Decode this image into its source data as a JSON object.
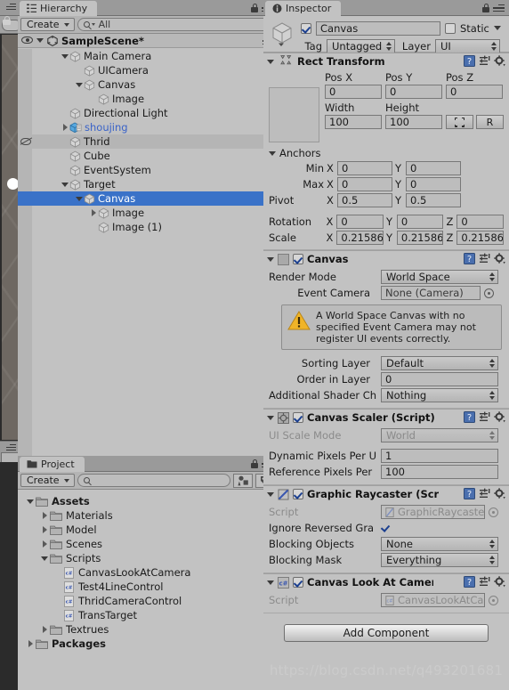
{
  "scene_sliver": {
    "name": "scene-view-sliver"
  },
  "hierarchy": {
    "tab_label": "Hierarchy",
    "create_label": "Create",
    "search_placeholder": "All",
    "search_value": "All",
    "scene_name": "SampleScene*",
    "selection_color": "#3a72c8",
    "items": [
      {
        "label": "Main Camera",
        "indent": 2,
        "expand": "down",
        "icon": "cube-icon",
        "selected": false,
        "alt": false,
        "hidden": false,
        "prefab": false
      },
      {
        "label": "UICamera",
        "indent": 3,
        "expand": "none",
        "icon": "cube-icon",
        "selected": false,
        "alt": false,
        "hidden": false,
        "prefab": false
      },
      {
        "label": "Canvas",
        "indent": 3,
        "expand": "down",
        "icon": "cube-icon",
        "selected": false,
        "alt": false,
        "hidden": false,
        "prefab": false
      },
      {
        "label": "Image",
        "indent": 4,
        "expand": "none",
        "icon": "cube-icon",
        "selected": false,
        "alt": false,
        "hidden": false,
        "prefab": false
      },
      {
        "label": "Directional Light",
        "indent": 2,
        "expand": "none",
        "icon": "cube-icon",
        "selected": false,
        "alt": false,
        "hidden": false,
        "prefab": false
      },
      {
        "label": "shoujing",
        "indent": 2,
        "expand": "right",
        "icon": "prefab-icon",
        "selected": false,
        "alt": false,
        "hidden": false,
        "prefab": true
      },
      {
        "label": "Thrid",
        "indent": 2,
        "expand": "none",
        "icon": "cube-icon",
        "selected": false,
        "alt": true,
        "hidden": true,
        "prefab": false
      },
      {
        "label": "Cube",
        "indent": 2,
        "expand": "none",
        "icon": "cube-icon",
        "selected": false,
        "alt": false,
        "hidden": false,
        "prefab": false
      },
      {
        "label": "EventSystem",
        "indent": 2,
        "expand": "none",
        "icon": "cube-icon",
        "selected": false,
        "alt": false,
        "hidden": false,
        "prefab": false
      },
      {
        "label": "Target",
        "indent": 2,
        "expand": "down",
        "icon": "cube-icon",
        "selected": false,
        "alt": false,
        "hidden": false,
        "prefab": false
      },
      {
        "label": "Canvas",
        "indent": 3,
        "expand": "down",
        "icon": "cube-icon",
        "selected": true,
        "alt": false,
        "hidden": false,
        "prefab": false
      },
      {
        "label": "Image",
        "indent": 4,
        "expand": "right",
        "icon": "cube-icon",
        "selected": false,
        "alt": false,
        "hidden": false,
        "prefab": false
      },
      {
        "label": "Image (1)",
        "indent": 4,
        "expand": "none",
        "icon": "cube-icon",
        "selected": false,
        "alt": false,
        "hidden": false,
        "prefab": false
      }
    ]
  },
  "project": {
    "tab_label": "Project",
    "create_label": "Create",
    "search_value": "",
    "items": [
      {
        "label": "Assets",
        "indent": 0,
        "expand": "down",
        "icon": "folder-icon",
        "bold": true
      },
      {
        "label": "Materials",
        "indent": 1,
        "expand": "right",
        "icon": "folder-icon",
        "bold": false
      },
      {
        "label": "Model",
        "indent": 1,
        "expand": "right",
        "icon": "folder-icon",
        "bold": false
      },
      {
        "label": "Scenes",
        "indent": 1,
        "expand": "right",
        "icon": "folder-icon",
        "bold": false
      },
      {
        "label": "Scripts",
        "indent": 1,
        "expand": "down",
        "icon": "folder-icon",
        "bold": false
      },
      {
        "label": "CanvasLookAtCamera",
        "indent": 2,
        "expand": "none",
        "icon": "csharp-icon",
        "bold": false
      },
      {
        "label": "Test4LineControl",
        "indent": 2,
        "expand": "none",
        "icon": "csharp-icon",
        "bold": false
      },
      {
        "label": "ThridCameraControl",
        "indent": 2,
        "expand": "none",
        "icon": "csharp-icon",
        "bold": false
      },
      {
        "label": "TransTarget",
        "indent": 2,
        "expand": "none",
        "icon": "csharp-icon",
        "bold": false
      },
      {
        "label": "Textrues",
        "indent": 1,
        "expand": "right",
        "icon": "folder-icon",
        "bold": false
      },
      {
        "label": "Packages",
        "indent": 0,
        "expand": "right",
        "icon": "folder-icon",
        "bold": true
      }
    ]
  },
  "inspector": {
    "tab_label": "Inspector",
    "object": {
      "enabled": true,
      "name": "Canvas",
      "static_label": "Static",
      "static_checked": false,
      "tag_label": "Tag",
      "tag_value": "Untagged",
      "layer_label": "Layer",
      "layer_value": "UI"
    },
    "rect_transform": {
      "title": "Rect Transform",
      "pos_x_label": "Pos X",
      "pos_x": "0",
      "pos_y_label": "Pos Y",
      "pos_y": "0",
      "pos_z_label": "Pos Z",
      "pos_z": "0",
      "width_label": "Width",
      "width": "100",
      "height_label": "Height",
      "height": "100",
      "blueprint_label": "",
      "raw_label": "R",
      "anchors_label": "Anchors",
      "min_label": "Min",
      "min_x": "0",
      "min_y": "0",
      "max_label": "Max",
      "max_x": "0",
      "max_y": "0",
      "pivot_label": "Pivot",
      "pivot_x": "0.5",
      "pivot_y": "0.5",
      "rotation_label": "Rotation",
      "rot_x": "0",
      "rot_y": "0",
      "rot_z": "0",
      "scale_label": "Scale",
      "scale_x": "0.21586",
      "scale_y": "0.21586",
      "scale_z": "0.21586",
      "axis_x": "X",
      "axis_y": "Y",
      "axis_z": "Z"
    },
    "canvas": {
      "title": "Canvas",
      "enabled": true,
      "render_mode_label": "Render Mode",
      "render_mode_value": "World Space",
      "event_camera_label": "Event Camera",
      "event_camera_value": "None (Camera)",
      "warning_text": "A World Space Canvas with no specified Event Camera may not register UI events correctly.",
      "sorting_layer_label": "Sorting Layer",
      "sorting_layer_value": "Default",
      "order_in_layer_label": "Order in Layer",
      "order_in_layer_value": "0",
      "additional_shader_label": "Additional Shader Ch",
      "additional_shader_value": "Nothing"
    },
    "canvas_scaler": {
      "title": "Canvas Scaler (Script)",
      "enabled": true,
      "ui_scale_mode_label": "UI Scale Mode",
      "ui_scale_mode_value": "World",
      "dynamic_pixels_label": "Dynamic Pixels Per U",
      "dynamic_pixels_value": "1",
      "reference_pixels_label": "Reference Pixels Per",
      "reference_pixels_value": "100"
    },
    "graphic_raycaster": {
      "title": "Graphic Raycaster (Scr",
      "enabled": true,
      "script_label": "Script",
      "script_value": "GraphicRaycaster",
      "ignore_reversed_label": "Ignore Reversed Gra",
      "ignore_reversed_checked": true,
      "blocking_objects_label": "Blocking Objects",
      "blocking_objects_value": "None",
      "blocking_mask_label": "Blocking Mask",
      "blocking_mask_value": "Everything"
    },
    "canvas_look_at": {
      "title": "Canvas Look At Camera",
      "enabled": true,
      "script_label": "Script",
      "script_value": "CanvasLookAtCa"
    },
    "add_component_label": "Add Component"
  },
  "watermark": "https://blog.csdn.net/q493201681"
}
